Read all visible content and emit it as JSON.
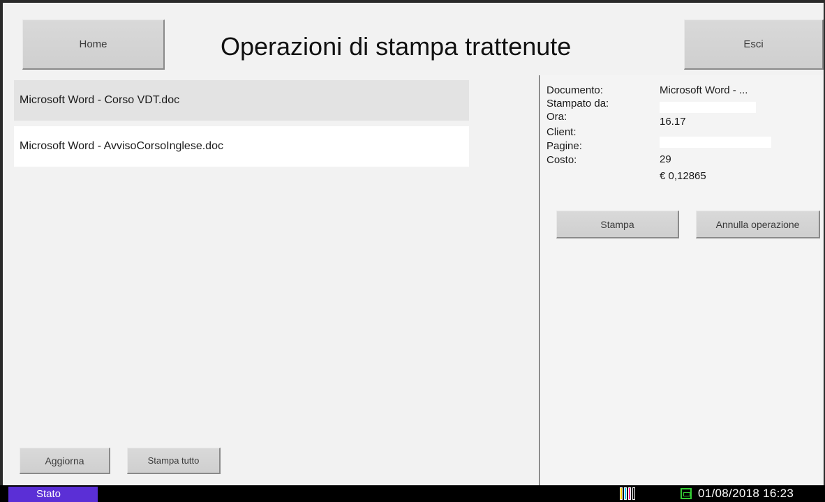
{
  "header": {
    "title": "Operazioni di stampa trattenute",
    "home_label": "Home",
    "exit_label": "Esci"
  },
  "jobs": {
    "items": [
      {
        "name": "Microsoft Word - Corso VDT.doc",
        "selected": true
      },
      {
        "name": "Microsoft Word - AvvisoCorsoInglese.doc",
        "selected": false
      }
    ],
    "refresh_label": "Aggiorna",
    "print_all_label": "Stampa tutto"
  },
  "details": {
    "document_label": "Documento:",
    "document_value": "Microsoft Word - ...",
    "printed_by_label": "Stampato da:",
    "printed_by_value": "",
    "time_label": "Ora:",
    "time_value": "16.17",
    "client_label": "Client:",
    "client_value": "",
    "pages_label": "Pagine:",
    "pages_value": "29",
    "cost_label": "Costo:",
    "cost_value": "€ 0,12865",
    "print_label": "Stampa",
    "cancel_label": "Annulla operazione"
  },
  "statusbar": {
    "status_label": "Stato",
    "datetime": "01/08/2018  16:23",
    "toner_colors": [
      "#ffd400",
      "#00c8ff",
      "#ff2fa0",
      "#000000"
    ],
    "network_icon": "network-icon"
  }
}
